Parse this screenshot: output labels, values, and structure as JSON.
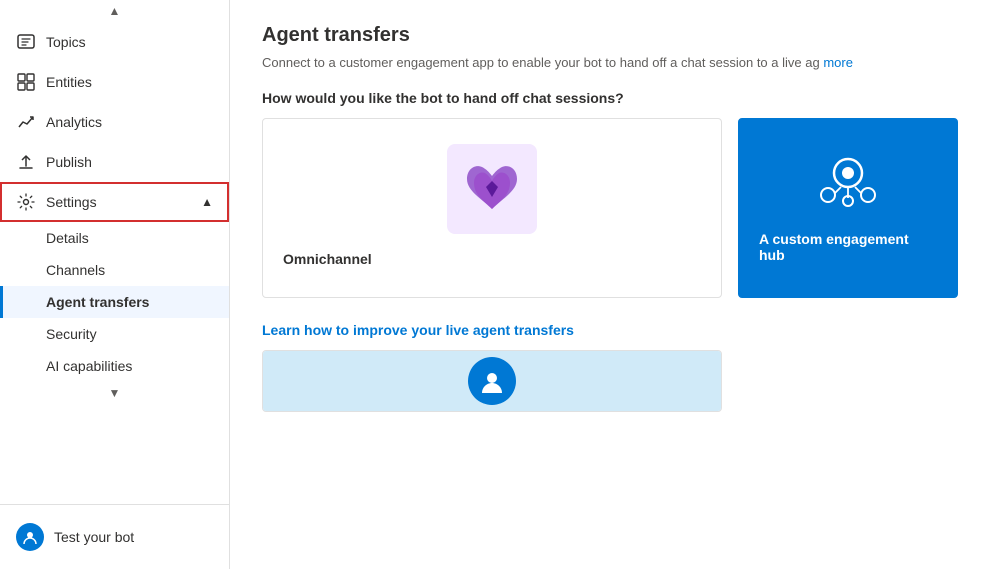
{
  "sidebar": {
    "items": [
      {
        "id": "topics",
        "label": "Topics",
        "icon": "💬"
      },
      {
        "id": "entities",
        "label": "Entities",
        "icon": "⊞"
      },
      {
        "id": "analytics",
        "label": "Analytics",
        "icon": "↗"
      },
      {
        "id": "publish",
        "label": "Publish",
        "icon": "↑"
      },
      {
        "id": "settings",
        "label": "Settings",
        "icon": "⚙"
      }
    ],
    "settings_sub": [
      {
        "id": "details",
        "label": "Details"
      },
      {
        "id": "channels",
        "label": "Channels"
      },
      {
        "id": "agent-transfers",
        "label": "Agent transfers",
        "active": true
      },
      {
        "id": "security",
        "label": "Security"
      },
      {
        "id": "ai-capabilities",
        "label": "AI capabilities"
      }
    ],
    "test_bot": "Test your bot"
  },
  "main": {
    "title": "Agent transfers",
    "description": "Connect to a customer engagement app to enable your bot to hand off a chat session to a live ag",
    "description_link": "more",
    "section1_title": "How would you like the bot to hand off chat sessions?",
    "card1_label": "Omnichannel",
    "card2_label": "A custom engagement hub",
    "section2_title": "Learn how to improve your live agent transfers"
  }
}
